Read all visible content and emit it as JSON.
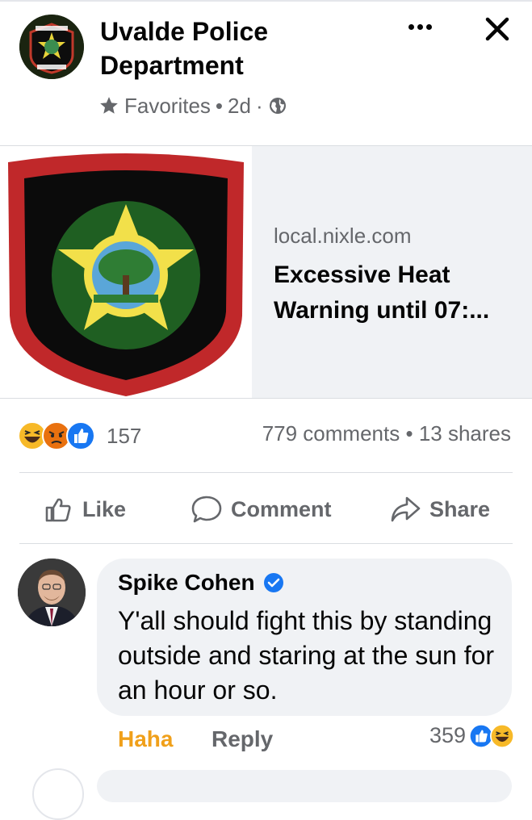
{
  "post": {
    "page_name": "Uvalde Police Department",
    "audience": "Favorites",
    "time": "2d",
    "separator_bullet": "•",
    "separator_dot": "·",
    "icons": {
      "more": "more-horizontal-icon",
      "close": "close-icon",
      "star": "star-icon",
      "globe": "globe-icon"
    }
  },
  "link_card": {
    "domain": "local.nixle.com",
    "title": "Excessive Heat Warning until 07:...",
    "thumbnail": "uvalde-police-badge-image"
  },
  "reactions": {
    "types": [
      "haha",
      "angry",
      "like"
    ],
    "count": "157",
    "comments": "779 comments",
    "separator": "•",
    "shares": "13 shares"
  },
  "actions": {
    "like": "Like",
    "comment": "Comment",
    "share": "Share"
  },
  "comment": {
    "author": "Spike Cohen",
    "verified": true,
    "text": "Y'all should fight this by standing outside and staring at the sun for an hour or so.",
    "reaction_label": "Haha",
    "reply": "Reply",
    "reaction_count": "359",
    "reaction_types": [
      "like",
      "haha"
    ]
  },
  "colors": {
    "text": "#050505",
    "secondary": "#65676b",
    "like_blue": "#1877f2",
    "haha_yellow": "#f7b928",
    "angry_orange": "#e9710f",
    "haha_label": "#f0a01a",
    "bubble": "#f0f2f5"
  }
}
